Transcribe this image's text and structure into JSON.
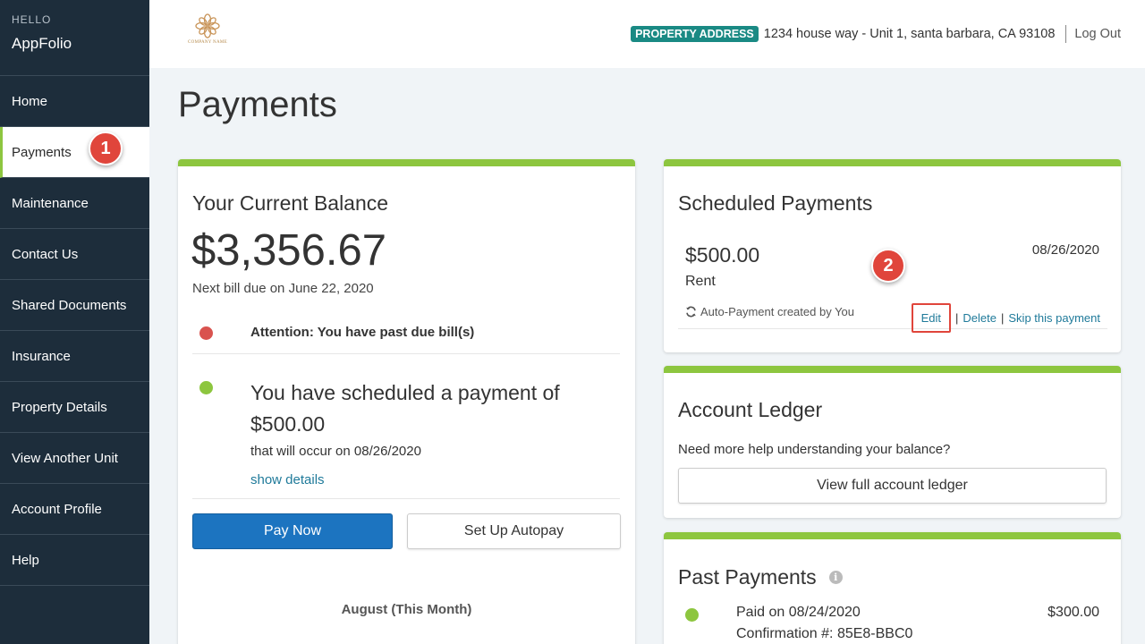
{
  "sidebar": {
    "greeting": "HELLO",
    "brand": "AppFolio",
    "items": [
      {
        "label": "Home"
      },
      {
        "label": "Payments"
      },
      {
        "label": "Maintenance"
      },
      {
        "label": "Contact Us"
      },
      {
        "label": "Shared Documents"
      },
      {
        "label": "Insurance"
      },
      {
        "label": "Property Details"
      },
      {
        "label": "View Another Unit"
      },
      {
        "label": "Account Profile"
      },
      {
        "label": "Help"
      }
    ],
    "active_index": 1
  },
  "annotations": {
    "step1": "1",
    "step2": "2"
  },
  "header": {
    "logo_text": "COMPANY NAME",
    "property_badge": "PROPERTY ADDRESS",
    "address": "1234 house way - Unit 1, santa barbara, CA 93108",
    "logout": "Log Out"
  },
  "page": {
    "title": "Payments"
  },
  "balance": {
    "title": "Your Current Balance",
    "amount": "$3,356.67",
    "next_bill": "Next bill due on June 22, 2020",
    "alert": "Attention: You have past due bill(s)",
    "scheduled_line1": "You have scheduled a payment of",
    "scheduled_amount": "$500.00",
    "scheduled_occur": "that will occur on 08/26/2020",
    "show_details": "show details",
    "pay_now": "Pay Now",
    "autopay": "Set Up Autopay",
    "month_label": "August (This Month)"
  },
  "scheduled": {
    "title": "Scheduled Payments",
    "amount": "$500.00",
    "date": "08/26/2020",
    "type": "Rent",
    "auto_text": "Auto-Payment created by You",
    "edit": "Edit",
    "delete": "Delete",
    "skip": "Skip this payment",
    "separator": "|"
  },
  "ledger": {
    "title": "Account Ledger",
    "help": "Need more help understanding your balance?",
    "button": "View full account ledger"
  },
  "past": {
    "title": "Past Payments",
    "info_glyph": "i",
    "paid_on": "Paid on 08/24/2020",
    "confirmation": "Confirmation #: 85E8-BBC0",
    "amount": "$300.00"
  },
  "colors": {
    "sidebar_bg": "#1d2d3b",
    "accent_green": "#8dc63f",
    "primary_blue": "#1c74c0",
    "badge_teal": "#1a8a84",
    "alert_red": "#d9534f",
    "annotation_red": "#e0453b",
    "link": "#1f7a9a"
  }
}
